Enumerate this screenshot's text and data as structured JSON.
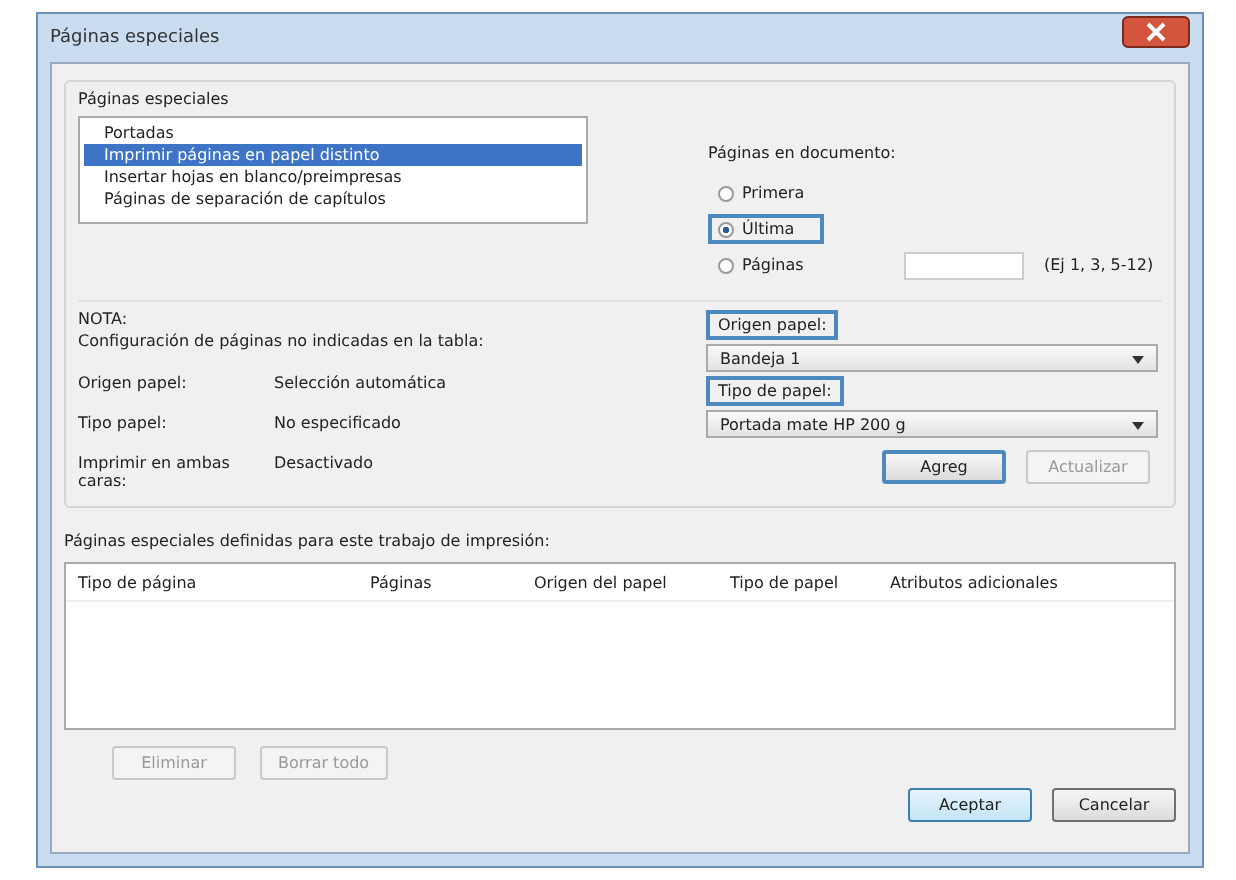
{
  "window": {
    "title": "Páginas especiales"
  },
  "group": {
    "title": "Páginas especiales"
  },
  "page_types": [
    {
      "label": "Portadas",
      "selected": false
    },
    {
      "label": "Imprimir páginas en papel distinto",
      "selected": true
    },
    {
      "label": "Insertar hojas en blanco/preimpresas",
      "selected": false
    },
    {
      "label": "Páginas de separación de capítulos",
      "selected": false
    }
  ],
  "pages_in_document": {
    "label": "Páginas en documento:",
    "options": [
      {
        "label": "Primera",
        "selected": false,
        "highlighted": false
      },
      {
        "label": "Última",
        "selected": true,
        "highlighted": true
      },
      {
        "label": "Páginas",
        "selected": false,
        "highlighted": false
      }
    ],
    "pages_hint": "(Ej 1, 3, 5-12)"
  },
  "note": {
    "title": "NOTA:",
    "text": "Configuración de páginas no indicadas en la tabla:",
    "rows": [
      {
        "label": "Origen papel:",
        "value": "Selección automática"
      },
      {
        "label": "Tipo papel:",
        "value": "No especificado"
      },
      {
        "label": "Imprimir en ambas caras:",
        "value": "Desactivado"
      }
    ]
  },
  "paper_source": {
    "label": "Origen papel:",
    "highlighted": true,
    "value": "Bandeja 1"
  },
  "paper_type": {
    "label": "Tipo de papel:",
    "highlighted": true,
    "value": "Portada mate HP 200 g"
  },
  "action_buttons": [
    {
      "label": "Agreg",
      "disabled": false,
      "highlighted": true
    },
    {
      "label": "Actualizar",
      "disabled": true,
      "highlighted": false
    }
  ],
  "table": {
    "caption": "Páginas especiales definidas para este trabajo de impresión:",
    "columns": [
      "Tipo de página",
      "Páginas",
      "Origen del papel",
      "Tipo de papel",
      "Atributos adicionales"
    ]
  },
  "table_buttons": [
    {
      "label": "Eliminar",
      "disabled": true
    },
    {
      "label": "Borrar todo",
      "disabled": true
    }
  ],
  "dialog_buttons": [
    {
      "label": "Aceptar",
      "default": true
    },
    {
      "label": "Cancelar",
      "default": false
    }
  ]
}
